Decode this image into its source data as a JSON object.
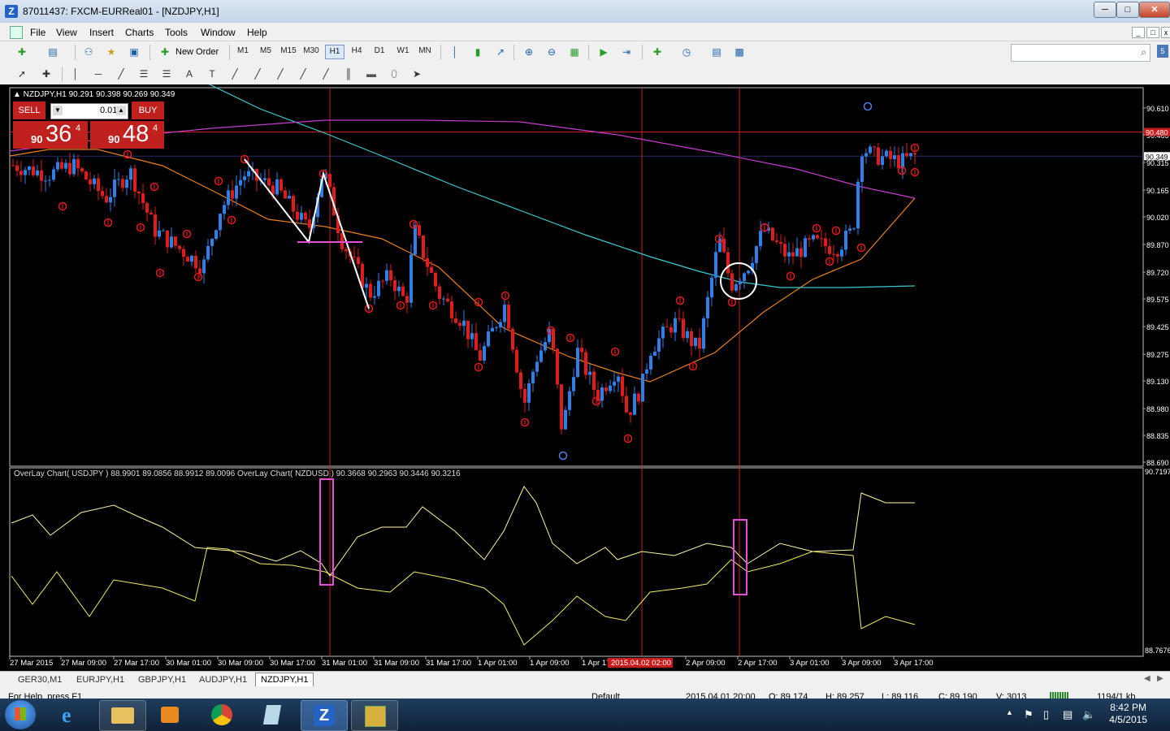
{
  "window": {
    "title": "87011437: FXCM-EURReal01 - [NZDJPY,H1]"
  },
  "menu": [
    "File",
    "View",
    "Insert",
    "Charts",
    "Tools",
    "Window",
    "Help"
  ],
  "toolbar": {
    "new_order": "New Order",
    "timeframes": [
      "M1",
      "M5",
      "M15",
      "M30",
      "H1",
      "H4",
      "D1",
      "W1",
      "MN"
    ],
    "selected_timeframe": "H1"
  },
  "chart": {
    "header": "▲ NZDJPY,H1  90.291 90.398 90.269 90.349",
    "price_labels": [
      "90.610",
      "90.465",
      "90.315",
      "90.165",
      "90.020",
      "89.870",
      "89.720",
      "89.575",
      "89.425",
      "89.275",
      "89.130",
      "88.980",
      "88.835",
      "88.690"
    ],
    "current_bid": "90.349",
    "ask_line": "90.480",
    "indicator_header": "OverLay Chart( USDJPY ) 88.9901 89.0856 88.9912 89.0096  OverLay Chart( NZDUSD ) 90.3668 90.2963 90.3446 90.3216",
    "indicator_scale": [
      "90.7197",
      "88.7676"
    ],
    "time_labels": [
      "27 Mar 2015",
      "27 Mar 09:00",
      "27 Mar 17:00",
      "30 Mar 01:00",
      "30 Mar 09:00",
      "30 Mar 17:00",
      "31 Mar 01:00",
      "31 Mar 09:00",
      "31 Mar 17:00",
      "1 Apr 01:00",
      "1 Apr 09:00",
      "1 Apr 17",
      "2 Apr 09:00",
      "2 Apr 17:00",
      "3 Apr 01:00",
      "3 Apr 09:00",
      "3 Apr 17:00"
    ],
    "time_highlight": "2015.04.02 02:00"
  },
  "trade_panel": {
    "sell_label": "SELL",
    "buy_label": "BUY",
    "lot": "0.01",
    "sell_big": "36",
    "sell_small": "90",
    "sell_sup": "4",
    "buy_big": "48",
    "buy_small": "90",
    "buy_sup": "4"
  },
  "tabs": [
    "GER30,M1",
    "EURJPY,H1",
    "GBPJPY,H1",
    "AUDJPY,H1",
    "NZDJPY,H1"
  ],
  "active_tab": "NZDJPY,H1",
  "status": {
    "help": "For Help, press F1",
    "profile": "Default",
    "time": "2015.04.01 20:00",
    "open": "O: 89.174",
    "high": "H: 89.257",
    "low": "L: 89.116",
    "close": "C: 89.190",
    "volume": "V: 3013",
    "traffic": "1194/1 kb"
  },
  "clock": {
    "time": "8:42 PM",
    "date": "4/5/2015"
  },
  "colors": {
    "bull": "#2f7fe8",
    "bear": "#e01c1c",
    "ma_fast": "#e8801f",
    "ma_mid": "#3fc9cf",
    "ma_slow": "#c63ccf",
    "annotation_pink": "#e64ed9"
  }
}
